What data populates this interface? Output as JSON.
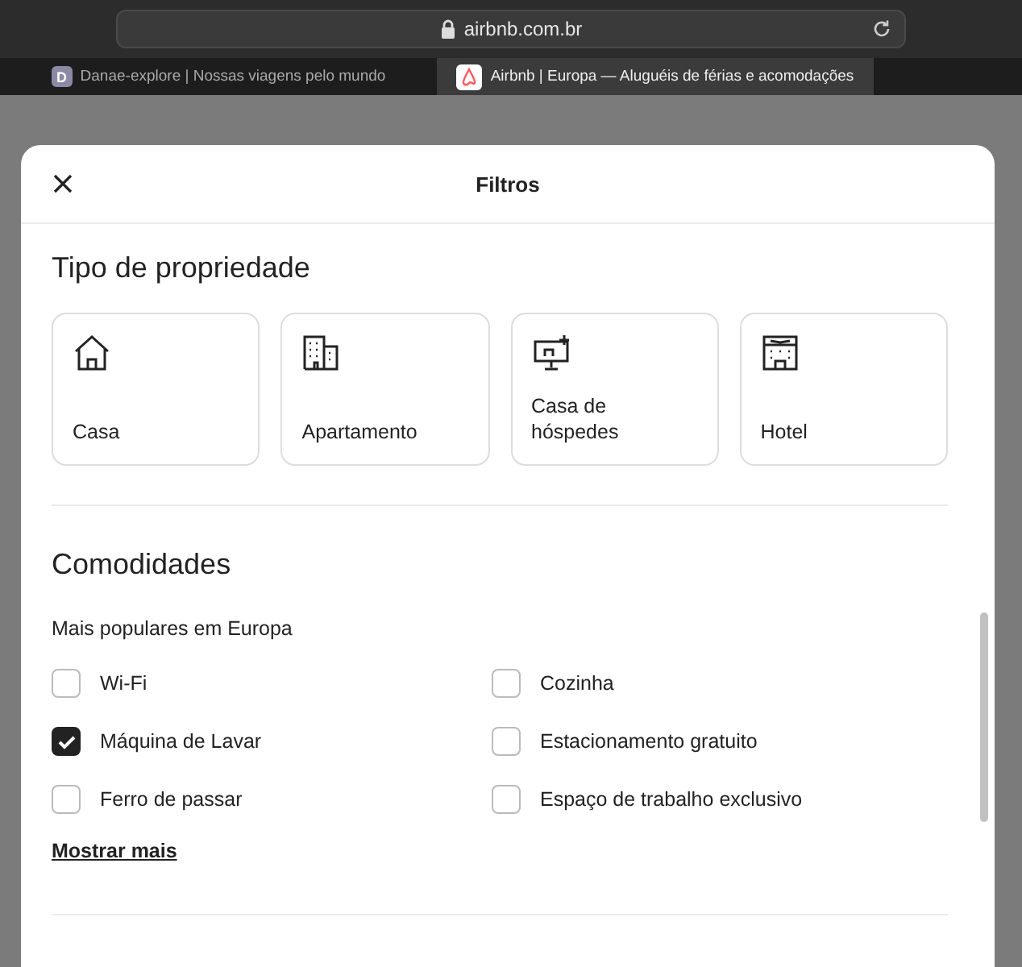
{
  "browser": {
    "address": "airbnb.com.br",
    "tabs": [
      {
        "label": "Danae-explore | Nossas viagens pelo mundo",
        "favicon": "D",
        "selected": false
      },
      {
        "label": "Airbnb | Europa — Aluguéis de férias e acomodações",
        "selected": true
      }
    ]
  },
  "modal": {
    "title": "Filtros",
    "property_type": {
      "heading": "Tipo de propriedade",
      "options": [
        {
          "label": "Casa",
          "kind": "house",
          "selected": false
        },
        {
          "label": "Apartamento",
          "kind": "apartment",
          "selected": false
        },
        {
          "label": "Casa de hóspedes",
          "kind": "guesthouse",
          "selected": false
        },
        {
          "label": "Hotel",
          "kind": "hotel",
          "selected": false
        }
      ]
    },
    "amenities": {
      "heading": "Comodidades",
      "subheading": "Mais populares em Europa",
      "items": [
        {
          "label": "Wi-Fi",
          "checked": false
        },
        {
          "label": "Cozinha",
          "checked": false
        },
        {
          "label": "Máquina de Lavar",
          "checked": true
        },
        {
          "label": "Estacionamento gratuito",
          "checked": false
        },
        {
          "label": "Ferro de passar",
          "checked": false
        },
        {
          "label": "Espaço de trabalho exclusivo",
          "checked": false
        }
      ],
      "show_more": "Mostrar mais"
    }
  }
}
